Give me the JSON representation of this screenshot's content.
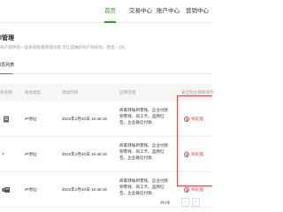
{
  "nav": {
    "tabs": [
      {
        "label": "首页",
        "active": true
      },
      {
        "label": "交易中心",
        "active": false
      },
      {
        "label": "账户中心",
        "active": false
      },
      {
        "label": "营销中心",
        "active": false
      }
    ]
  },
  "page": {
    "title": "l管理",
    "description": "商户提供前一些系统能量管理功能,可让运维护商户持续化、稳定、(对。"
  },
  "subtabs": [
    {
      "label": "l员列表",
      "active": true
    }
  ],
  "table": {
    "headers": [
      "系名称",
      "系统类型",
      "添加时间",
      "应用范围",
      "安全指主保研领作"
    ],
    "rows": [
      {
        "name": "",
        "type": "IP地址",
        "time": "2022年4月20日 15:46:18",
        "scope": "商家转账到零钱、企业付款到零钱、商工卡、品牌红包、企业微信付款",
        "status": "待处理"
      },
      {
        "name": "7",
        "type": "IP地址",
        "time": "2022年4月20日 15:46:18",
        "scope": "商家转账到零钱、企业付款到零钱、商工卡、品牌红包、企业微信付款",
        "status": "待处理"
      },
      {
        "name": "",
        "type": "IP地址",
        "time": "2022年4月20日 15:46:18",
        "scope": "商家转账到零钱、企业付款到零钱、商工卡、品牌红包、企业微信付款",
        "status": "待处理"
      }
    ]
  },
  "pagination": {
    "info": "共3条",
    "prev_symbol": "‹",
    "next_symbol": "›"
  },
  "colors": {
    "accent": "#1aad19",
    "alert": "#e64340"
  }
}
